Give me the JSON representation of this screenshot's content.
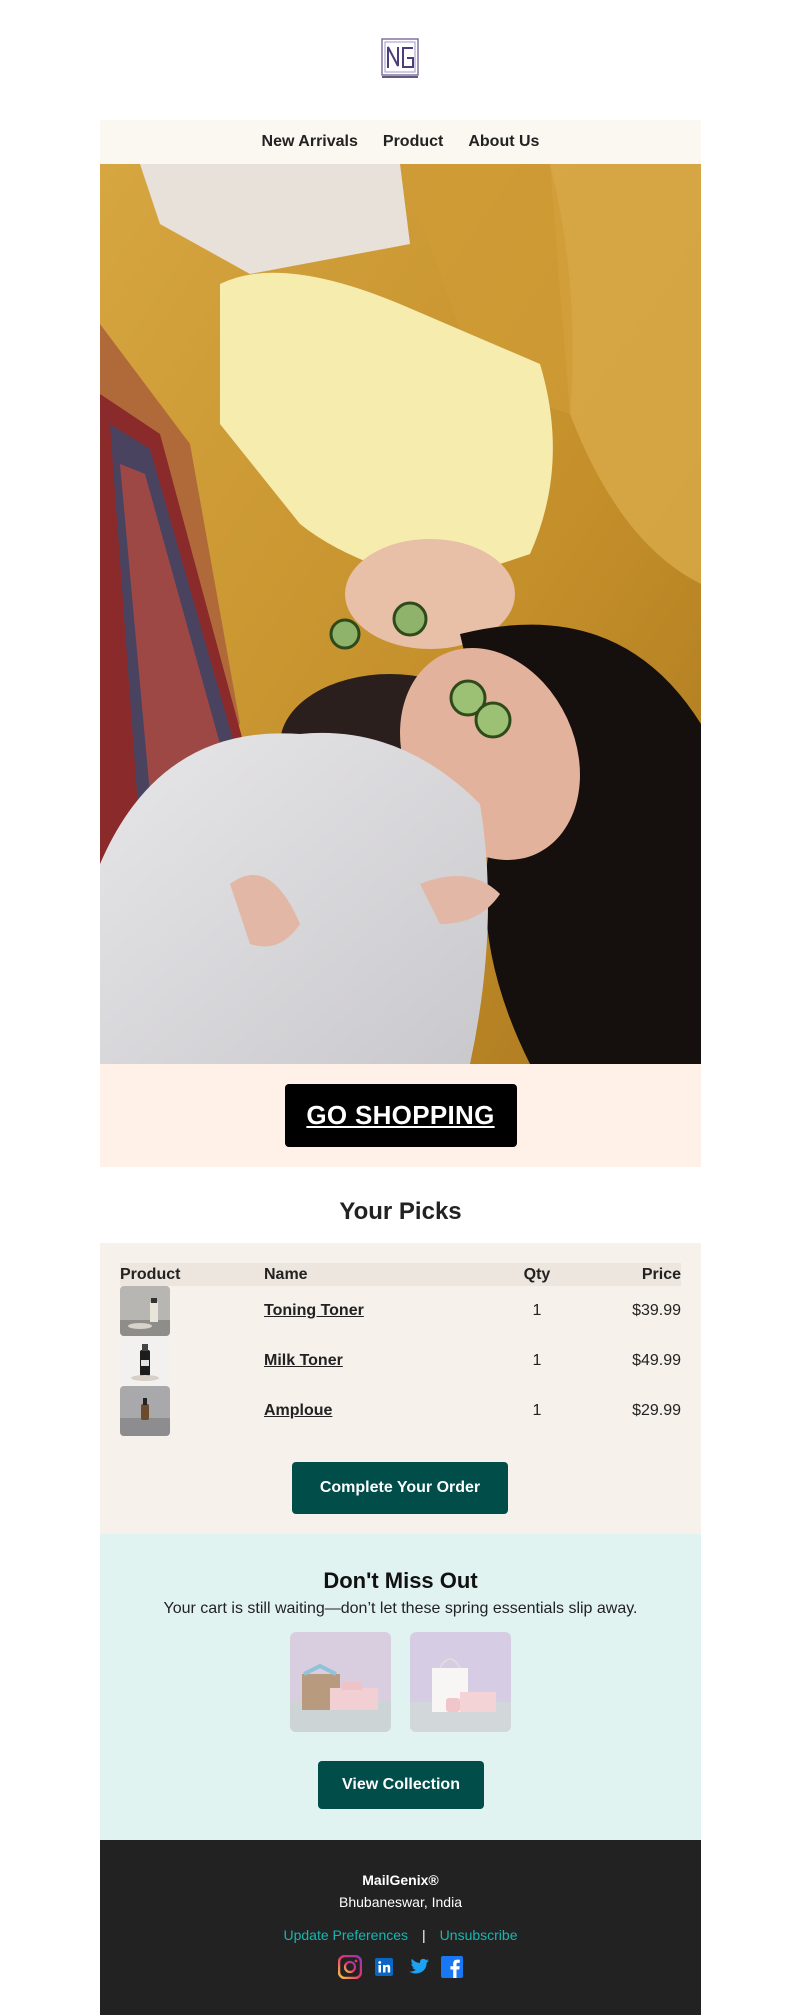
{
  "brand": {
    "logo_icon": "ng-logo-icon"
  },
  "nav": {
    "items": [
      {
        "label": "New Arrivals"
      },
      {
        "label": "Product"
      },
      {
        "label": "About Us"
      }
    ]
  },
  "hero": {
    "image": "two-women-cucumber-eye-masks-on-sofa"
  },
  "cta": {
    "label": "GO SHOPPING"
  },
  "picks": {
    "title": "Your Picks",
    "headers": {
      "product": "Product",
      "name": "Name",
      "qty": "Qty",
      "price": "Price"
    },
    "rows": [
      {
        "name": "Toning Toner",
        "qty": "1",
        "price": "$39.99",
        "thumb": "toner-bottle-thumb"
      },
      {
        "name": "Milk Toner",
        "qty": "1",
        "price": "$49.99",
        "thumb": "milk-toner-bottle-thumb"
      },
      {
        "name": "Amploue",
        "qty": "1",
        "price": "$29.99",
        "thumb": "ampoule-bottle-thumb"
      }
    ],
    "button_label": "Complete Your Order"
  },
  "miss": {
    "title": "Don't Miss Out",
    "subtitle": "Your cart is still waiting—don’t let these spring essentials slip away.",
    "images": [
      "gift-box-thumb",
      "shopping-bag-thumb"
    ],
    "button_label": "View Collection"
  },
  "footer": {
    "brand": "MailGenix®",
    "location": "Bhubaneswar, India",
    "update_label": "Update Preferences",
    "separator": "|",
    "unsubscribe_label": "Unsubscribe",
    "social": [
      "instagram-icon",
      "linkedin-icon",
      "twitter-icon",
      "facebook-icon"
    ]
  },
  "colors": {
    "accent": "#004d4a",
    "link": "#19b5b0",
    "footer_bg": "#222222",
    "nav_bg": "#fbf7f1",
    "picks_bg": "#f7f1ec",
    "miss_bg": "#e1f3f1",
    "cta_bg": "#fff0e8"
  }
}
